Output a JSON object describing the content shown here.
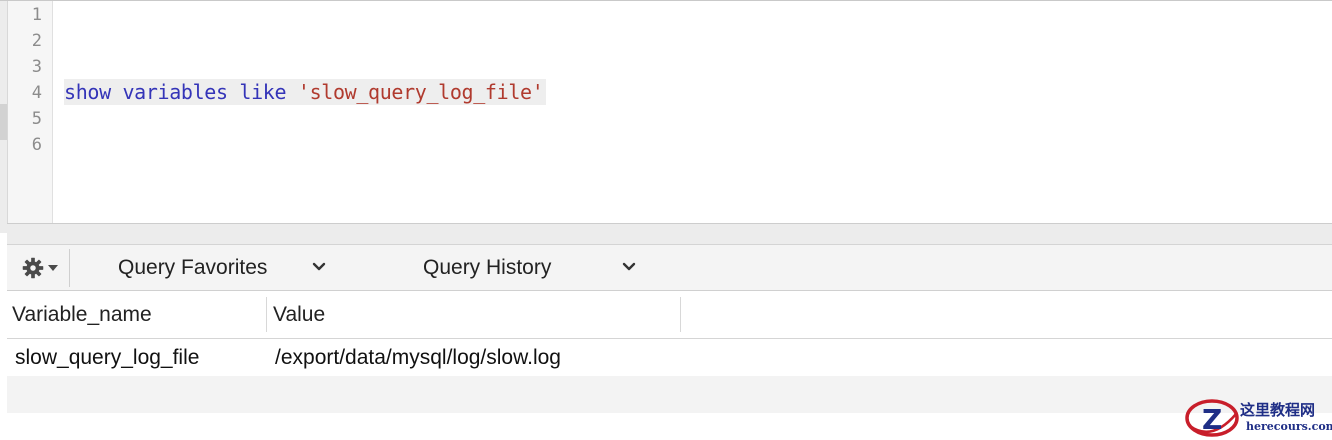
{
  "editor": {
    "line_numbers": [
      "1",
      "2",
      "3",
      "4",
      "5",
      "6"
    ],
    "code": {
      "kw1": "show",
      "kw2": "variables",
      "kw3": "like",
      "string": "'slow_query_log_file'"
    },
    "colors": {
      "keyword": "#3434b8",
      "string": "#b03a2e"
    }
  },
  "toolbar": {
    "gear_icon": "gear-icon",
    "favorites_label": "Query Favorites",
    "history_label": "Query History"
  },
  "results": {
    "columns": [
      "Variable_name",
      "Value"
    ],
    "rows": [
      [
        "slow_query_log_file",
        "/export/data/mysql/log/slow.log"
      ]
    ]
  },
  "watermark": {
    "title": "这里教程网",
    "subtitle": "herecours.com",
    "logo_letter": "Z"
  }
}
